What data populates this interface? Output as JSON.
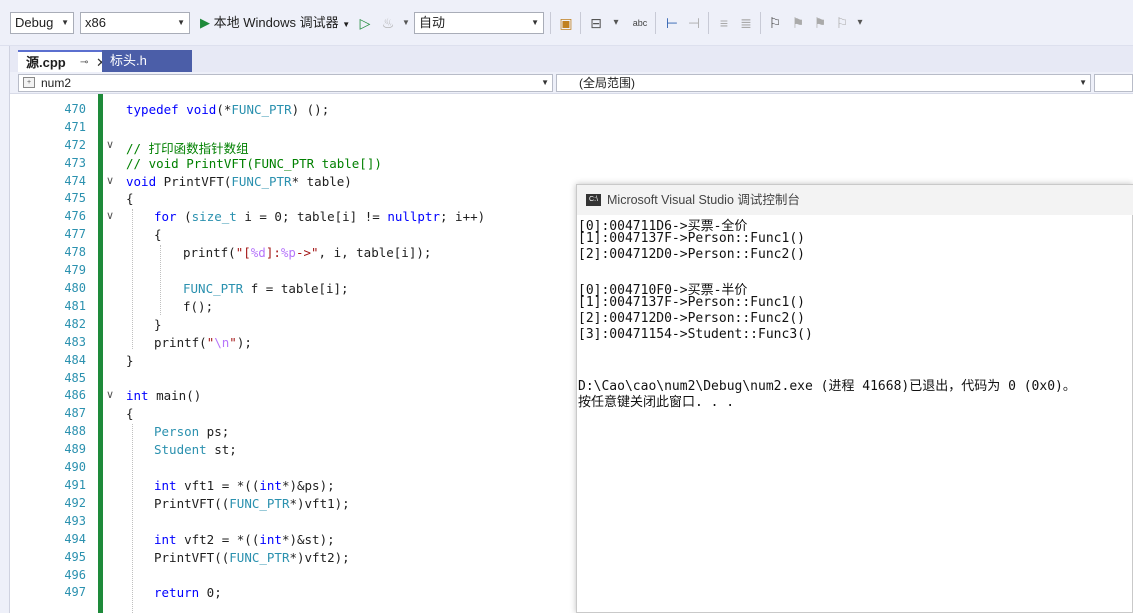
{
  "toolbar": {
    "config": "Debug",
    "platform": "x86",
    "run_label": "本地 Windows 调试器",
    "solution_config": "自动"
  },
  "tabs": [
    {
      "label": "源.cpp",
      "active": true
    },
    {
      "label": "标头.h",
      "active": false
    }
  ],
  "nav": {
    "project": "num2",
    "scope": "(全局范围)"
  },
  "editor": {
    "lines": [
      {
        "n": "470",
        "t": "typedef void(*FUNC_PTR) ();"
      },
      {
        "n": "471",
        "t": ""
      },
      {
        "n": "472",
        "t": "// 打印函数指针数组"
      },
      {
        "n": "473",
        "t": "// void PrintVFT(FUNC_PTR table[])"
      },
      {
        "n": "474",
        "t": "void PrintVFT(FUNC_PTR* table)"
      },
      {
        "n": "475",
        "t": "{"
      },
      {
        "n": "476",
        "t": "for (size_t i = 0; table[i] != nullptr; i++)"
      },
      {
        "n": "477",
        "t": "{"
      },
      {
        "n": "478",
        "t": "printf(\"[%d]:%p->\", i, table[i]);"
      },
      {
        "n": "479",
        "t": ""
      },
      {
        "n": "480",
        "t": "FUNC_PTR f = table[i];"
      },
      {
        "n": "481",
        "t": "f();"
      },
      {
        "n": "482",
        "t": "}"
      },
      {
        "n": "483",
        "t": "printf(\"\\n\");"
      },
      {
        "n": "484",
        "t": "}"
      },
      {
        "n": "485",
        "t": ""
      },
      {
        "n": "486",
        "t": "int main()"
      },
      {
        "n": "487",
        "t": "{"
      },
      {
        "n": "488",
        "t": "Person ps;"
      },
      {
        "n": "489",
        "t": "Student st;"
      },
      {
        "n": "490",
        "t": ""
      },
      {
        "n": "491",
        "t": "int vft1 = *((int*)&ps);"
      },
      {
        "n": "492",
        "t": "PrintVFT((FUNC_PTR*)vft1);"
      },
      {
        "n": "493",
        "t": ""
      },
      {
        "n": "494",
        "t": "int vft2 = *((int*)&st);"
      },
      {
        "n": "495",
        "t": "PrintVFT((FUNC_PTR*)vft2);"
      },
      {
        "n": "496",
        "t": ""
      },
      {
        "n": "497",
        "t": "return 0;"
      }
    ]
  },
  "console": {
    "title": "Microsoft Visual Studio 调试控制台",
    "lines": [
      "[0]:004711D6->买票-全价",
      "[1]:0047137F->Person::Func1()",
      "[2]:004712D0->Person::Func2()",
      "",
      "[0]:004710F0->买票-半价",
      "[1]:0047137F->Person::Func1()",
      "[2]:004712D0->Person::Func2()",
      "[3]:00471154->Student::Func3()",
      "",
      "",
      "D:\\Cao\\cao\\num2\\Debug\\num2.exe (进程 41668)已退出，代码为 0 (0x0)。",
      "按任意键关闭此窗口. . ."
    ]
  },
  "colors": {
    "keyword": "#0000ff",
    "type": "#2b91af",
    "comment": "#008000",
    "string": "#a31515",
    "change_bar": "#1e8a3a",
    "tab_active_accent": "#5b6fcf"
  }
}
